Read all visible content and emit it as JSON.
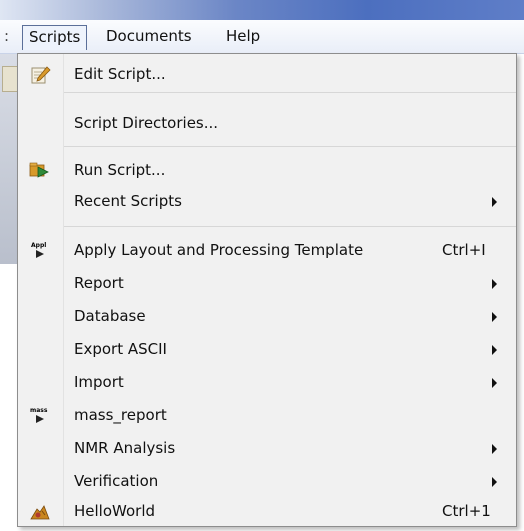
{
  "menubar": {
    "stub": ":",
    "items": [
      "Scripts",
      "Documents",
      "Help"
    ]
  },
  "dropdown": {
    "items": [
      {
        "label": "Edit Script...",
        "icon": "edit-script-icon",
        "shortcut": "",
        "submenu": false
      },
      {
        "label": "Script Directories...",
        "icon": "",
        "shortcut": "",
        "submenu": false
      },
      {
        "label": "Run Script...",
        "icon": "run-script-icon",
        "shortcut": "",
        "submenu": false
      },
      {
        "label": "Recent Scripts",
        "icon": "",
        "shortcut": "",
        "submenu": true
      },
      {
        "label": "Apply Layout and Processing Template",
        "icon": "apply-template-icon",
        "icon_text": "Appl",
        "shortcut": "Ctrl+I",
        "submenu": false
      },
      {
        "label": "Report",
        "icon": "",
        "shortcut": "",
        "submenu": true
      },
      {
        "label": "Database",
        "icon": "",
        "shortcut": "",
        "submenu": true
      },
      {
        "label": "Export ASCII",
        "icon": "",
        "shortcut": "",
        "submenu": true
      },
      {
        "label": "Import",
        "icon": "",
        "shortcut": "",
        "submenu": true
      },
      {
        "label": "mass_report",
        "icon": "mass-report-icon",
        "icon_text": "mass",
        "shortcut": "",
        "submenu": false
      },
      {
        "label": "NMR Analysis",
        "icon": "",
        "shortcut": "",
        "submenu": true
      },
      {
        "label": "Verification",
        "icon": "",
        "shortcut": "",
        "submenu": true
      },
      {
        "label": "HelloWorld",
        "icon": "hello-world-icon",
        "shortcut": "Ctrl+1",
        "submenu": false
      }
    ]
  }
}
